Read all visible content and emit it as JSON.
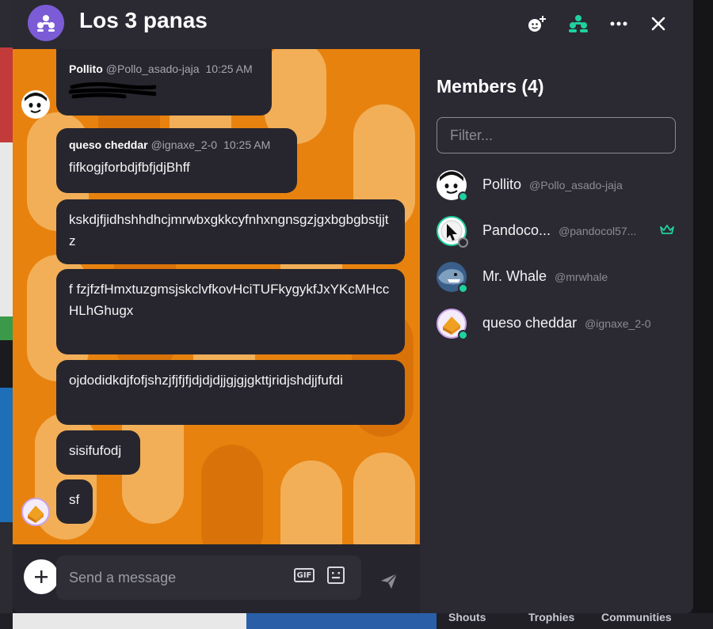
{
  "window": {
    "title": "Los 3 panas"
  },
  "header": {
    "add_member_icon": "add-emoji-person-icon",
    "members_icon": "members-icon",
    "more_icon": "more-icon",
    "close_icon": "close-icon"
  },
  "messages": [
    {
      "name": "Pollito",
      "handle": "@Pollo_asado-jaja",
      "time": "10:25 AM",
      "text": ""
    },
    {
      "name": "queso cheddar",
      "handle": "@ignaxe_2-0",
      "time": "10:25 AM",
      "text": "fifkogjforbdjfbfjdjBhff"
    },
    {
      "text": "kskdjfjidhshhdhcjmrwbxgkkcyfnhxngnsgzjgxbgbgbstjjtz"
    },
    {
      "text": "f fzjfzfHmxtuzgmsjskclvfkovHciTUFkygykfJxYKcMHccHLhGhugx"
    },
    {
      "text": "ojdodidkdjfofjshzjfjfjfjdjdjdjjgjgjgkttjridjshdjjfufdi"
    },
    {
      "text": "sisifufodj"
    },
    {
      "text": "sf"
    }
  ],
  "composer": {
    "placeholder": "Send a message",
    "gif_label": "GIF"
  },
  "members_panel": {
    "title": "Members (4)",
    "filter_placeholder": "Filter...",
    "members": [
      {
        "name": "Pollito",
        "handle": "@Pollo_asado-jaja",
        "status": "online"
      },
      {
        "name": "Pandoco...",
        "handle": "@pandocol57...",
        "status": "offline",
        "owner": true
      },
      {
        "name": "Mr. Whale",
        "handle": "@mrwhale",
        "status": "online"
      },
      {
        "name": "queso cheddar",
        "handle": "@ignaxe_2-0",
        "status": "online"
      }
    ]
  },
  "bottom_nav": [
    "Shouts",
    "Trophies",
    "Communities"
  ],
  "colors": {
    "accent": "#1fd1a0",
    "chat_bg": "#e8820e",
    "bubble": "#27262e",
    "panel": "#2b2a33"
  }
}
